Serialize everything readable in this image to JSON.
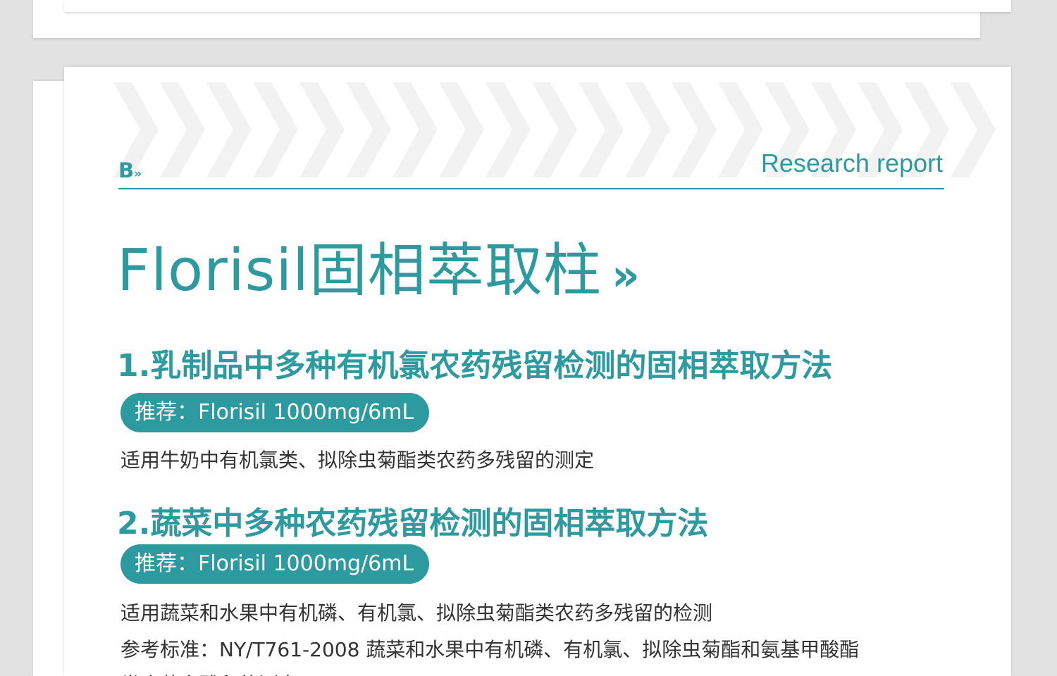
{
  "header": {
    "logo_letter": "B",
    "logo_mark": "»",
    "tagline": "Research report"
  },
  "title": {
    "text": "Florisil固相萃取柱",
    "mark": "»"
  },
  "sections": [
    {
      "heading": "1.乳制品中多种有机氯农药残留检测的固相萃取方法",
      "recommend": "推荐：Florisil 1000mg/6mL",
      "lines": [
        "适用牛奶中有机氯类、拟除虫菊酯类农药多残留的测定"
      ]
    },
    {
      "heading": "2.蔬菜中多种农药残留检测的固相萃取方法",
      "recommend": "推荐：Florisil 1000mg/6mL",
      "lines": [
        "适用蔬菜和水果中有机磷、有机氯、拟除虫菊酯类农药多残留的检测",
        "参考标准：NY/T761-2008 蔬菜和水果中有机磷、有机氯、拟除虫菊酯和氨基甲酸酯",
        "类农药多残留的测定"
      ]
    }
  ],
  "colors": {
    "accent": "#2d9aa0",
    "background": "#e2e2e2",
    "card": "#ffffff",
    "chevron": "#f2f2f2",
    "body_text": "#333333"
  },
  "icons": [
    "chevron-pattern-icon",
    "double-chevron-icon"
  ]
}
